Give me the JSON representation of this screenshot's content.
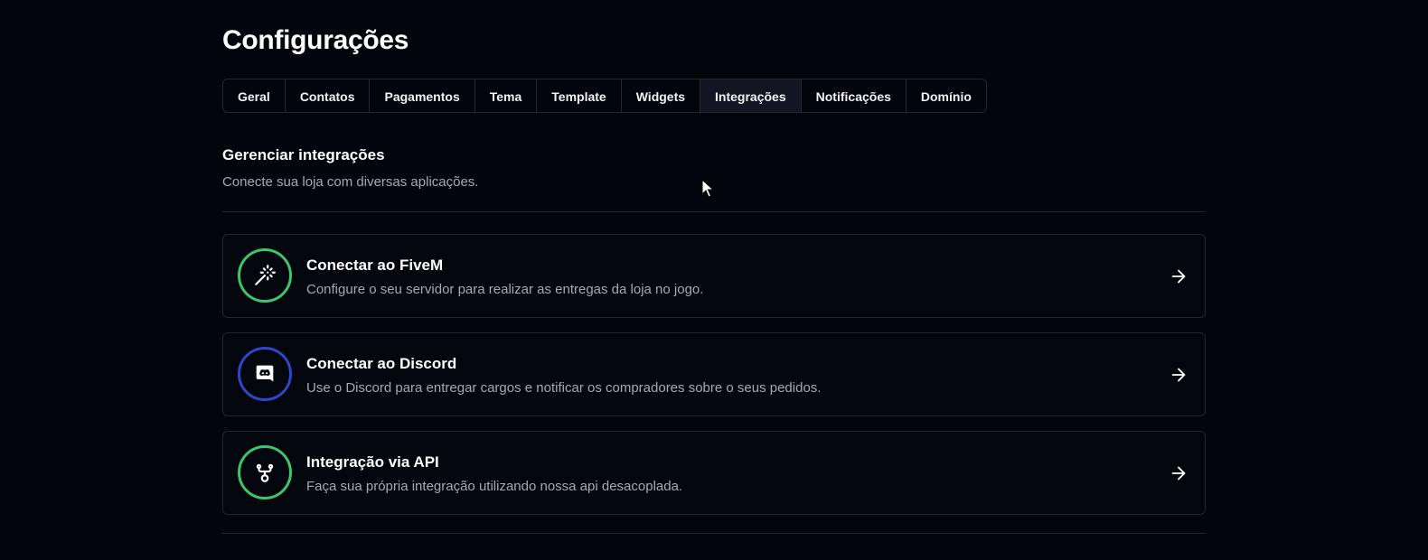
{
  "page": {
    "title": "Configurações"
  },
  "tabs": [
    {
      "label": "Geral"
    },
    {
      "label": "Contatos"
    },
    {
      "label": "Pagamentos"
    },
    {
      "label": "Tema"
    },
    {
      "label": "Template"
    },
    {
      "label": "Widgets"
    },
    {
      "label": "Integrações",
      "active": true
    },
    {
      "label": "Notificações"
    },
    {
      "label": "Domínio"
    }
  ],
  "section": {
    "title": "Gerenciar integrações",
    "subtitle": "Conecte sua loja com diversas aplicações."
  },
  "integrations": [
    {
      "title": "Conectar ao FiveM",
      "description": "Configure o seu servidor para realizar as entregas da loja no jogo.",
      "icon": "magic-wand-icon",
      "ring_color": "#3ec46d"
    },
    {
      "title": "Conectar ao Discord",
      "description": "Use o Discord para entregar cargos e notificar os compradores sobre o seus pedidos.",
      "icon": "discord-icon",
      "ring_color": "#2e47c8"
    },
    {
      "title": "Integração via API",
      "description": "Faça sua própria integração utilizando nossa api desacoplada.",
      "icon": "git-fork-icon",
      "ring_color": "#3ec46d"
    }
  ],
  "colors": {
    "background": "#03050d",
    "border": "#23262f",
    "active_tab": "#121622",
    "muted_text": "#a6a9b3"
  }
}
